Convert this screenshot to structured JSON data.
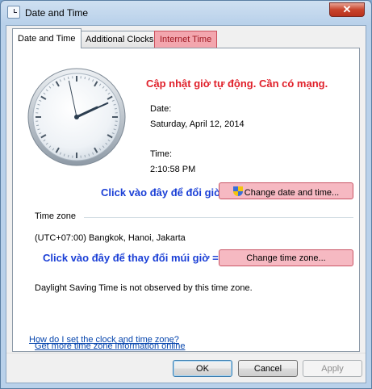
{
  "window": {
    "title": "Date and Time",
    "close_glyph": "✕",
    "title_icon": "clock-icon"
  },
  "tabs": [
    {
      "label": "Date and Time",
      "active": true
    },
    {
      "label": "Additional Clocks",
      "active": false
    },
    {
      "label": "Internet Time",
      "active": false,
      "highlight": true
    }
  ],
  "clock": {
    "hours": 2,
    "minutes": 10,
    "seconds": 58
  },
  "datetime": {
    "date_label": "Date:",
    "date_value": "Saturday, April 12, 2014",
    "time_label": "Time:",
    "time_value": "2:10:58 PM",
    "change_button": "Change date and time..."
  },
  "timezone": {
    "heading": "Time zone",
    "value": "(UTC+07:00) Bangkok, Hanoi, Jakarta",
    "change_button": "Change time zone...",
    "dst_note": "Daylight Saving Time is not observed by this time zone."
  },
  "annotations": {
    "internet_time": "Cập nhật giờ tự động. Cần có mạng.",
    "change_time": "Click vào đây để đổi giờ",
    "change_zone": "Click vào đây để thay đổi múi giờ =>"
  },
  "links": {
    "more_info": "Get more time zone information online",
    "how_to": "How do I set the clock and time zone?"
  },
  "buttons": {
    "ok": "OK",
    "cancel": "Cancel",
    "apply": "Apply"
  },
  "colors": {
    "annotation_red": "#e0202a",
    "annotation_blue": "#1a3fd6",
    "highlight_pink": "#f3a6ae"
  }
}
